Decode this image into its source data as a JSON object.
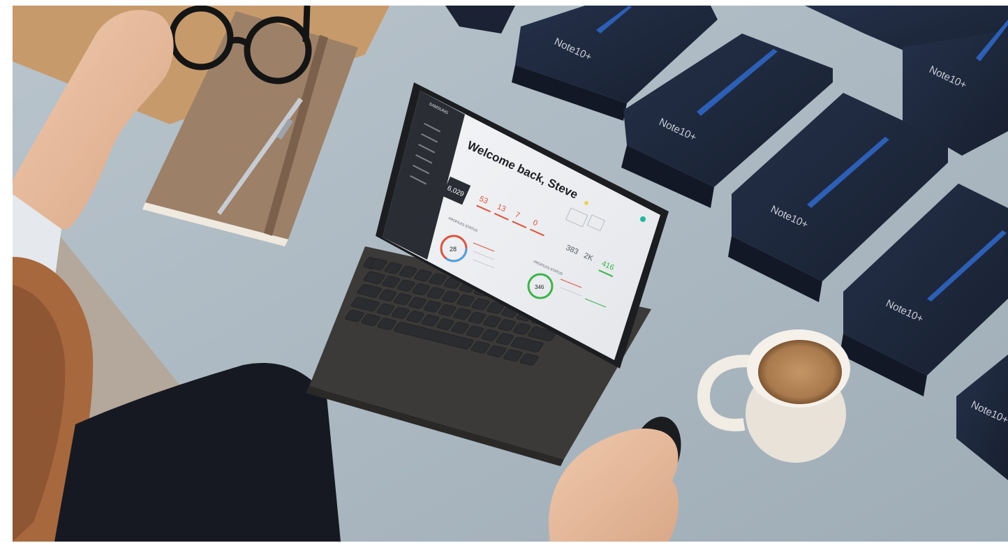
{
  "tablet": {
    "app": {
      "sidebar_header": "SAMSUNG",
      "welcome": "Welcome back, Steve"
    },
    "stats": {
      "big": "6,029",
      "row1": [
        "53",
        "13",
        "7",
        "0"
      ],
      "row2": [
        "383",
        "2K",
        "416"
      ]
    },
    "sections": {
      "profile1": "PROFILES STATUS",
      "profile2": "PROFILES STATUS"
    },
    "rings": {
      "ring1": "28",
      "ring2": "346"
    }
  },
  "boxes": [
    "Note10+",
    "Note10+",
    "Note10+",
    "Note10+",
    "Note10+",
    "Note10+"
  ],
  "colors": {
    "desk": "#a9b6bf",
    "floor": "#b3a89b",
    "box": "#1c2535",
    "spen": "#2d5fb6",
    "notebook": "#9c8068",
    "wood": "#c79a6b",
    "mug": "#f1ece4",
    "coffee": "#b88a5a",
    "accent_red": "#e0523d",
    "accent_green": "#39b54a",
    "accent_teal": "#21b8a0"
  }
}
